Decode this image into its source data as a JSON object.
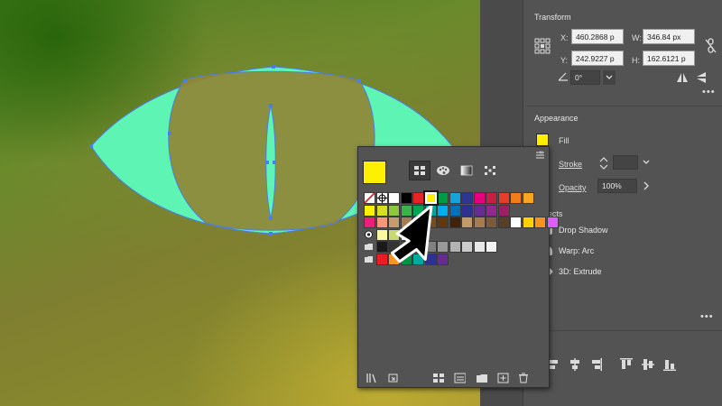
{
  "properties": {
    "transform": {
      "title": "Transform",
      "x_label": "X:",
      "x_value": "460.2868 p",
      "y_label": "Y:",
      "y_value": "242.9227 p",
      "w_label": "W:",
      "w_value": "346.84 px",
      "h_label": "H:",
      "h_value": "162.6121 p",
      "angle_value": "0°"
    },
    "appearance": {
      "title": "Appearance",
      "fill_label": "Fill",
      "fill_color": "#ffef00",
      "stroke_label": "Stroke",
      "opacity_label": "Opacity",
      "opacity_value": "100%",
      "effects_label": "Effects",
      "effects": [
        "Drop Shadow",
        "Warp: Arc",
        "3D: Extrude"
      ]
    }
  },
  "swatches": {
    "current_fill_color": "#ffef00",
    "view_buttons": [
      "swatch-view-icon",
      "color-palette-icon",
      "gradient-icon",
      "pattern-icon"
    ],
    "footer_buttons": [
      "swatch-libraries-icon",
      "place-swatches-icon",
      "show-swatch-kinds-icon",
      "swatch-options-icon",
      "new-color-group-icon",
      "new-swatch-icon",
      "delete-swatch-icon"
    ]
  },
  "colors": {
    "eye_fill": "#5ef5b4",
    "selection_blue": "#4a7de8",
    "panel_bg": "#535353",
    "canvas_green": "#5e8a2a"
  }
}
